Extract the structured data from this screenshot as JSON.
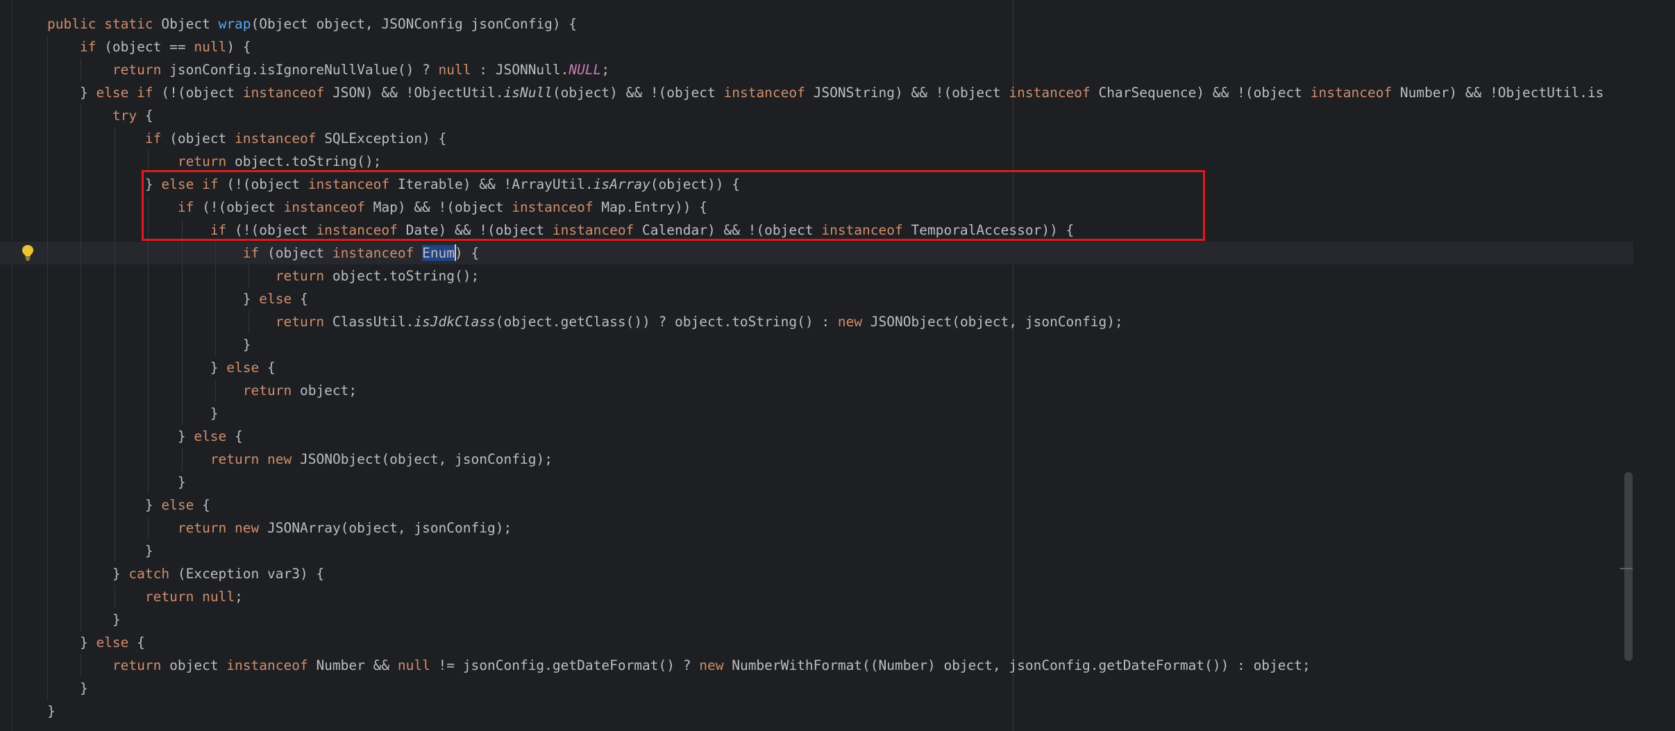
{
  "code_lines": [
    [
      {
        "t": "public",
        "c": "kw"
      },
      {
        "t": " "
      },
      {
        "t": "static",
        "c": "kw"
      },
      {
        "t": " Object "
      },
      {
        "t": "wrap",
        "c": "fn"
      },
      {
        "t": "(Object object, JSONConfig jsonConfig) {"
      }
    ],
    [
      {
        "t": "    "
      },
      {
        "t": "if",
        "c": "kw"
      },
      {
        "t": " (object == "
      },
      {
        "t": "null",
        "c": "kw"
      },
      {
        "t": ") {"
      }
    ],
    [
      {
        "t": "        "
      },
      {
        "t": "return",
        "c": "kw"
      },
      {
        "t": " jsonConfig.isIgnoreNullValue() ? "
      },
      {
        "t": "null",
        "c": "kw"
      },
      {
        "t": " : JSONNull."
      },
      {
        "t": "NULL",
        "c": "st"
      },
      {
        "t": ";"
      }
    ],
    [
      {
        "t": "    } "
      },
      {
        "t": "else",
        "c": "kw"
      },
      {
        "t": " "
      },
      {
        "t": "if",
        "c": "kw"
      },
      {
        "t": " (!(object "
      },
      {
        "t": "instanceof",
        "c": "kw"
      },
      {
        "t": " JSON) && !ObjectUtil."
      },
      {
        "t": "isNull",
        "c": "it"
      },
      {
        "t": "(object) && !(object "
      },
      {
        "t": "instanceof",
        "c": "kw"
      },
      {
        "t": " JSONString) && !(object "
      },
      {
        "t": "instanceof",
        "c": "kw"
      },
      {
        "t": " CharSequence) && !(object "
      },
      {
        "t": "instanceof",
        "c": "kw"
      },
      {
        "t": " Number) && !ObjectUtil.is"
      }
    ],
    [
      {
        "t": "        "
      },
      {
        "t": "try",
        "c": "kw"
      },
      {
        "t": " {"
      }
    ],
    [
      {
        "t": "            "
      },
      {
        "t": "if",
        "c": "kw"
      },
      {
        "t": " (object "
      },
      {
        "t": "instanceof",
        "c": "kw"
      },
      {
        "t": " SQLException) {"
      }
    ],
    [
      {
        "t": "                "
      },
      {
        "t": "return",
        "c": "kw"
      },
      {
        "t": " object.toString();"
      }
    ],
    [
      {
        "t": "            } "
      },
      {
        "t": "else",
        "c": "kw"
      },
      {
        "t": " "
      },
      {
        "t": "if",
        "c": "kw"
      },
      {
        "t": " (!(object "
      },
      {
        "t": "instanceof",
        "c": "kw"
      },
      {
        "t": " Iterable) && !ArrayUtil."
      },
      {
        "t": "isArray",
        "c": "it"
      },
      {
        "t": "(object)) {"
      }
    ],
    [
      {
        "t": "                "
      },
      {
        "t": "if",
        "c": "kw"
      },
      {
        "t": " (!(object "
      },
      {
        "t": "instanceof",
        "c": "kw"
      },
      {
        "t": " Map) && !(object "
      },
      {
        "t": "instanceof",
        "c": "kw"
      },
      {
        "t": " Map.Entry)) {"
      }
    ],
    [
      {
        "t": "                    "
      },
      {
        "t": "if",
        "c": "kw"
      },
      {
        "t": " (!(object "
      },
      {
        "t": "instanceof",
        "c": "kw"
      },
      {
        "t": " Date) && !(object "
      },
      {
        "t": "instanceof",
        "c": "kw"
      },
      {
        "t": " Calendar) && !(object "
      },
      {
        "t": "instanceof",
        "c": "kw"
      },
      {
        "t": " TemporalAccessor)) {"
      }
    ],
    [
      {
        "t": "                        "
      },
      {
        "t": "if",
        "c": "kw"
      },
      {
        "t": " (object "
      },
      {
        "t": "instanceof",
        "c": "kw"
      },
      {
        "t": " "
      },
      {
        "t": "Enum",
        "c": "sel"
      },
      {
        "t": "",
        "c": "caret"
      },
      {
        "t": ") {"
      }
    ],
    [
      {
        "t": "                            "
      },
      {
        "t": "return",
        "c": "kw"
      },
      {
        "t": " object.toString();"
      }
    ],
    [
      {
        "t": "                        } "
      },
      {
        "t": "else",
        "c": "kw"
      },
      {
        "t": " {"
      }
    ],
    [
      {
        "t": "                            "
      },
      {
        "t": "return",
        "c": "kw"
      },
      {
        "t": " ClassUtil."
      },
      {
        "t": "isJdkClass",
        "c": "it"
      },
      {
        "t": "(object.getClass()) ? object.toString() : "
      },
      {
        "t": "new",
        "c": "kw"
      },
      {
        "t": " JSONObject(object, jsonConfig);"
      }
    ],
    [
      {
        "t": "                        }"
      }
    ],
    [
      {
        "t": "                    } "
      },
      {
        "t": "else",
        "c": "kw"
      },
      {
        "t": " {"
      }
    ],
    [
      {
        "t": "                        "
      },
      {
        "t": "return",
        "c": "kw"
      },
      {
        "t": " object;"
      }
    ],
    [
      {
        "t": "                    }"
      }
    ],
    [
      {
        "t": "                } "
      },
      {
        "t": "else",
        "c": "kw"
      },
      {
        "t": " {"
      }
    ],
    [
      {
        "t": "                    "
      },
      {
        "t": "return",
        "c": "kw"
      },
      {
        "t": " "
      },
      {
        "t": "new",
        "c": "kw"
      },
      {
        "t": " JSONObject(object, jsonConfig);"
      }
    ],
    [
      {
        "t": "                }"
      }
    ],
    [
      {
        "t": "            } "
      },
      {
        "t": "else",
        "c": "kw"
      },
      {
        "t": " {"
      }
    ],
    [
      {
        "t": "                "
      },
      {
        "t": "return",
        "c": "kw"
      },
      {
        "t": " "
      },
      {
        "t": "new",
        "c": "kw"
      },
      {
        "t": " JSONArray(object, jsonConfig);"
      }
    ],
    [
      {
        "t": "            }"
      }
    ],
    [
      {
        "t": "        } "
      },
      {
        "t": "catch",
        "c": "kw"
      },
      {
        "t": " (Exception var3) {"
      }
    ],
    [
      {
        "t": "            "
      },
      {
        "t": "return",
        "c": "kw"
      },
      {
        "t": " "
      },
      {
        "t": "null",
        "c": "kw"
      },
      {
        "t": ";"
      }
    ],
    [
      {
        "t": "        }"
      }
    ],
    [
      {
        "t": "    } "
      },
      {
        "t": "else",
        "c": "kw"
      },
      {
        "t": " {"
      }
    ],
    [
      {
        "t": "        "
      },
      {
        "t": "return",
        "c": "kw"
      },
      {
        "t": " object "
      },
      {
        "t": "instanceof",
        "c": "kw"
      },
      {
        "t": " Number && "
      },
      {
        "t": "null",
        "c": "kw"
      },
      {
        "t": " != jsonConfig.getDateFormat() ? "
      },
      {
        "t": "new",
        "c": "kw"
      },
      {
        "t": " NumberWithFormat((Number) object, jsonConfig.getDateFormat()) : object;"
      }
    ],
    [
      {
        "t": "    }"
      }
    ],
    [
      {
        "t": "}"
      }
    ]
  ],
  "current_line_index": 10,
  "colors": {
    "background": "#1e1f22",
    "keyword": "#cf8e6d",
    "method_declaration": "#56a8f5",
    "static_constant": "#c77dbb",
    "default_text": "#bcbec4",
    "selection": "#214283",
    "annotation_box": "#e0191b",
    "intention_bulb": "#f0c336"
  },
  "icons": {
    "gutter_bulb": "lightbulb-icon"
  }
}
